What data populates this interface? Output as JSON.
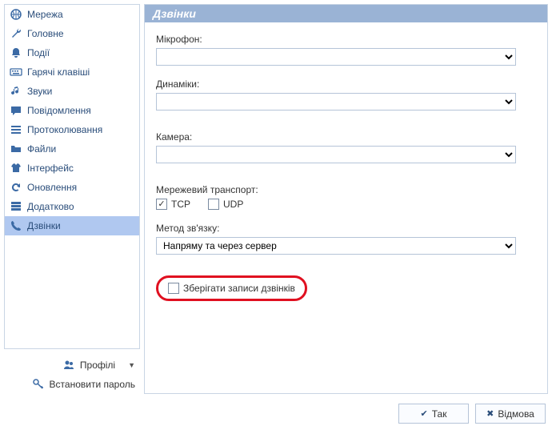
{
  "sidebar": {
    "items": [
      {
        "label": "Мережа"
      },
      {
        "label": "Головне"
      },
      {
        "label": "Події"
      },
      {
        "label": "Гарячі клавіші"
      },
      {
        "label": "Звуки"
      },
      {
        "label": "Повідомлення"
      },
      {
        "label": "Протоколювання"
      },
      {
        "label": "Файли"
      },
      {
        "label": "Інтерфейс"
      },
      {
        "label": "Оновлення"
      },
      {
        "label": "Додатково"
      },
      {
        "label": "Дзвінки"
      }
    ],
    "profiles_label": "Профілі",
    "set_password_label": "Встановити пароль"
  },
  "main": {
    "title": "Дзвінки",
    "microphone_label": "Мікрофон:",
    "microphone_value": "",
    "speakers_label": "Динаміки:",
    "speakers_value": "",
    "camera_label": "Камера:",
    "camera_value": "",
    "transport_label": "Мережевий транспорт:",
    "tcp_label": "TCP",
    "tcp_checked": true,
    "udp_label": "UDP",
    "udp_checked": false,
    "method_label": "Метод зв'язку:",
    "method_value": "Напряму та через сервер",
    "save_records_label": "Зберігати записи дзвінків",
    "save_records_checked": false
  },
  "buttons": {
    "ok": "Так",
    "cancel": "Відмова"
  }
}
